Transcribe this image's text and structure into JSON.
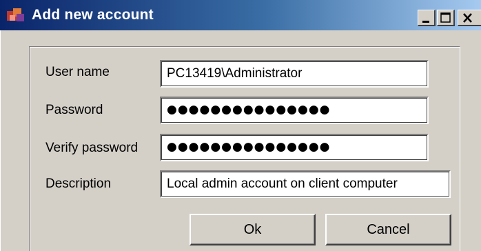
{
  "window": {
    "title": "Add new account",
    "controls": {
      "minimize_icon": "minimize-icon",
      "maximize_icon": "maximize-icon",
      "close_icon": "close-icon"
    },
    "colors": {
      "titlebar_start": "#0a246a",
      "titlebar_end": "#a6caf0",
      "face": "#d4d0c8"
    }
  },
  "form": {
    "user_name": {
      "label": "User name",
      "value": "PC13419\\Administrator"
    },
    "password": {
      "label": "Password",
      "value": "●●●●●●●●●●●●●●●"
    },
    "verify_password": {
      "label": "Verify password",
      "value": "●●●●●●●●●●●●●●●"
    },
    "description": {
      "label": "Description",
      "value": "Local admin account on client computer"
    }
  },
  "buttons": {
    "ok": "Ok",
    "cancel": "Cancel"
  }
}
